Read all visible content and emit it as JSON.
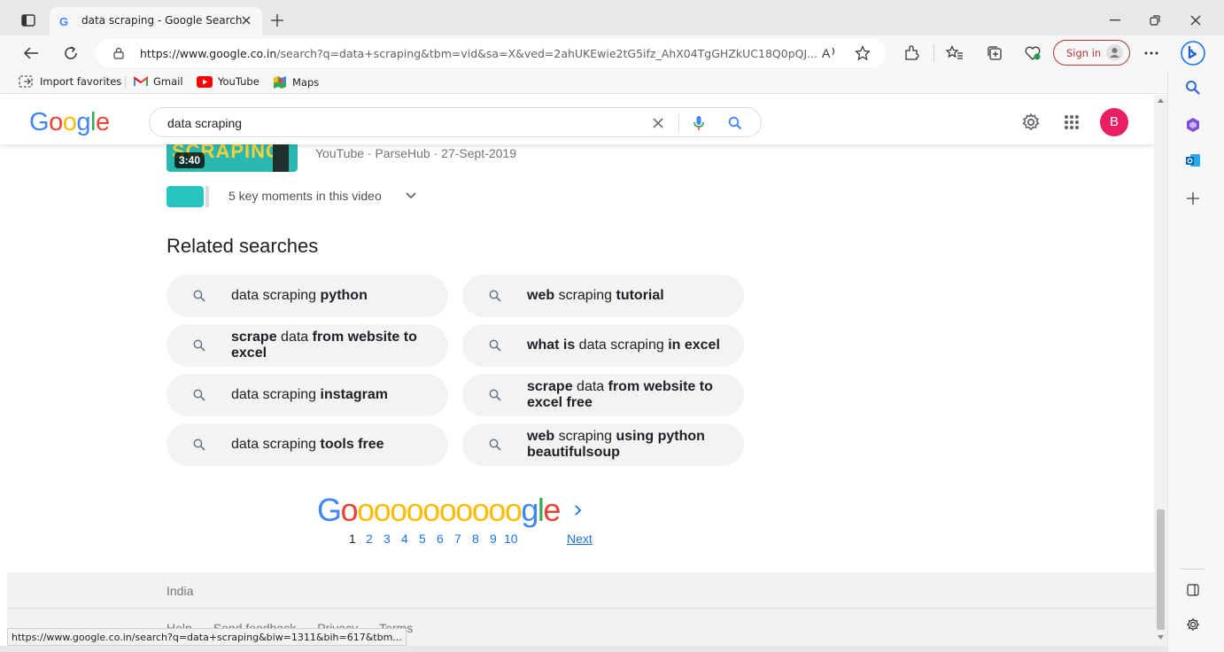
{
  "browser": {
    "tab_title": "data scraping - Google Search",
    "url_host": "https://www.google.co.in",
    "url_rest": "/search?q=data+scraping&tbm=vid&sa=X&ved=2ahUKEwie2tG5ifz_AhX04TgGHZkUC18Q0pQJ...",
    "sign_in_label": "Sign in",
    "favorites": [
      "Import favorites",
      "Gmail",
      "YouTube",
      "Maps"
    ]
  },
  "search": {
    "query": "data scraping",
    "avatar_letter": "B"
  },
  "video": {
    "thumb_text": "SCRAPING",
    "duration": "3:40",
    "meta": "YouTube · ParseHub · 27-Sept-2019",
    "key_moments": "5 key moments in this video"
  },
  "related": {
    "heading": "Related searches",
    "items": [
      {
        "pre": "data scraping ",
        "bold": "python",
        "post": ""
      },
      {
        "pre": "",
        "bold": "web",
        "post": " scraping ",
        "bold2": "tutorial"
      },
      {
        "pre": "",
        "bold": "scrape",
        "post": " data ",
        "bold2": "from website to excel"
      },
      {
        "pre": "",
        "bold": "what is",
        "post": " data scraping ",
        "bold2": "in excel"
      },
      {
        "pre": "data scraping ",
        "bold": "instagram",
        "post": ""
      },
      {
        "pre": "",
        "bold": "scrape",
        "post": " data ",
        "bold2": "from website to excel free"
      },
      {
        "pre": "data scraping ",
        "bold": "tools free",
        "post": ""
      },
      {
        "pre": "",
        "bold": "web",
        "post": " scraping ",
        "bold2": "using python beautifulsoup"
      }
    ]
  },
  "pagination": {
    "logo_letters": [
      "G",
      "o",
      "o",
      "o",
      "o",
      "o",
      "o",
      "o",
      "o",
      "o",
      "o",
      "o",
      "g",
      "l",
      "e"
    ],
    "pages": [
      "1",
      "2",
      "3",
      "4",
      "5",
      "6",
      "7",
      "8",
      "9",
      "10"
    ],
    "current": "1",
    "next_label": "Next"
  },
  "footer": {
    "country": "India",
    "links": [
      "Help",
      "Send feedback",
      "Privacy",
      "Terms"
    ]
  },
  "status_url": "https://www.google.co.in/search?q=data+scraping&biw=1311&bih=617&tbm...",
  "colors": {
    "google_blue": "#4285f4",
    "google_red": "#ea4335",
    "google_yellow": "#fbbc05",
    "google_green": "#34a853",
    "link_blue": "#1a73e8",
    "avatar_pink": "#e91e63",
    "sign_in_red": "#b2373d"
  }
}
